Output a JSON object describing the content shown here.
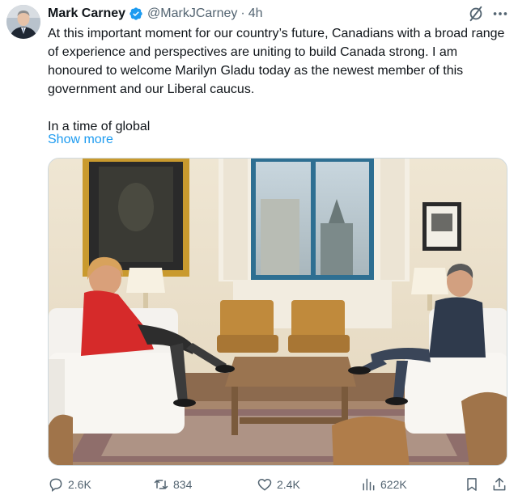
{
  "author": {
    "name": "Mark Carney",
    "handle": "@MarkJCarney",
    "separator": "·",
    "time": "4h"
  },
  "tweet": {
    "paragraph1": "At this important moment for our country’s future, Canadians with a broad range of experience and perspectives are uniting to build Canada strong. I am honoured to welcome Marilyn Gladu today as the newest member of this government and our Liberal caucus.",
    "paragraph2": "In a time of global",
    "show_more": "Show more"
  },
  "actions": {
    "replies": "2.6K",
    "reposts": "834",
    "likes": "2.4K",
    "views": "622K"
  },
  "icons": {
    "verified": "verified-badge-icon",
    "grok": "grok-icon",
    "more": "more-icon",
    "reply": "reply-icon",
    "repost": "repost-icon",
    "like": "like-icon",
    "views": "views-icon",
    "bookmark": "bookmark-icon",
    "share": "share-icon"
  },
  "colors": {
    "accent": "#1d9bf0",
    "text": "#0f1419",
    "muted": "#536471"
  }
}
